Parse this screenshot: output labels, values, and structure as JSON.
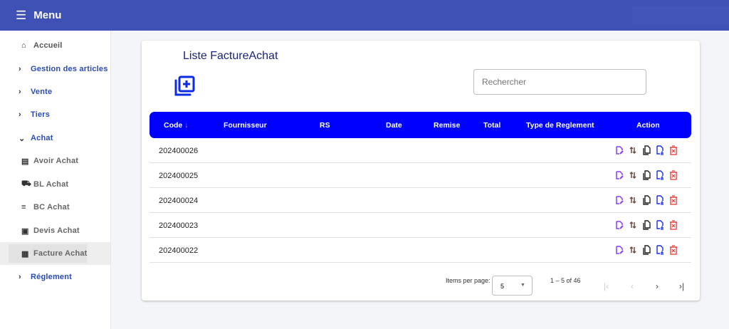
{
  "header": {
    "menu_icon": "hamburger-icon",
    "title": "Menu"
  },
  "sidebar": {
    "items": [
      {
        "label": "Accueil",
        "icon": "home-icon"
      },
      {
        "label": "Gestion des articles",
        "icon": "chevron-right-icon"
      },
      {
        "label": "Vente",
        "icon": "chevron-right-icon"
      },
      {
        "label": "Tiers",
        "icon": "chevron-right-icon"
      },
      {
        "label": "Achat",
        "icon": "chevron-down-icon"
      },
      {
        "label": "Avoir Achat",
        "icon": "receipt-icon"
      },
      {
        "label": "BL Achat",
        "icon": "truck-icon"
      },
      {
        "label": "BC Achat",
        "icon": "list-upload-icon"
      },
      {
        "label": "Devis Achat",
        "icon": "document-icon"
      },
      {
        "label": "Facture Achat",
        "icon": "invoice-icon"
      },
      {
        "label": "Réglement",
        "icon": "chevron-right-icon"
      }
    ]
  },
  "main": {
    "title": "Liste FactureAchat",
    "search_placeholder": "Rechercher",
    "columns": [
      "Code",
      "Fournisseur",
      "RS",
      "Date",
      "Remise",
      "Total",
      "Type de Reglement",
      "Action"
    ],
    "sort_icon": "↓",
    "rows": [
      {
        "code": "202400026"
      },
      {
        "code": "202400025"
      },
      {
        "code": "202400024"
      },
      {
        "code": "202400023"
      },
      {
        "code": "202400022"
      }
    ],
    "pagination": {
      "items_per_page_label": "Items per page:",
      "page_size": "5",
      "range": "1 – 5 of 46"
    }
  },
  "colors": {
    "header": "#3f51b5",
    "table_header": "#0000ff",
    "edit": "#8b3dff",
    "delete": "#e53935"
  }
}
